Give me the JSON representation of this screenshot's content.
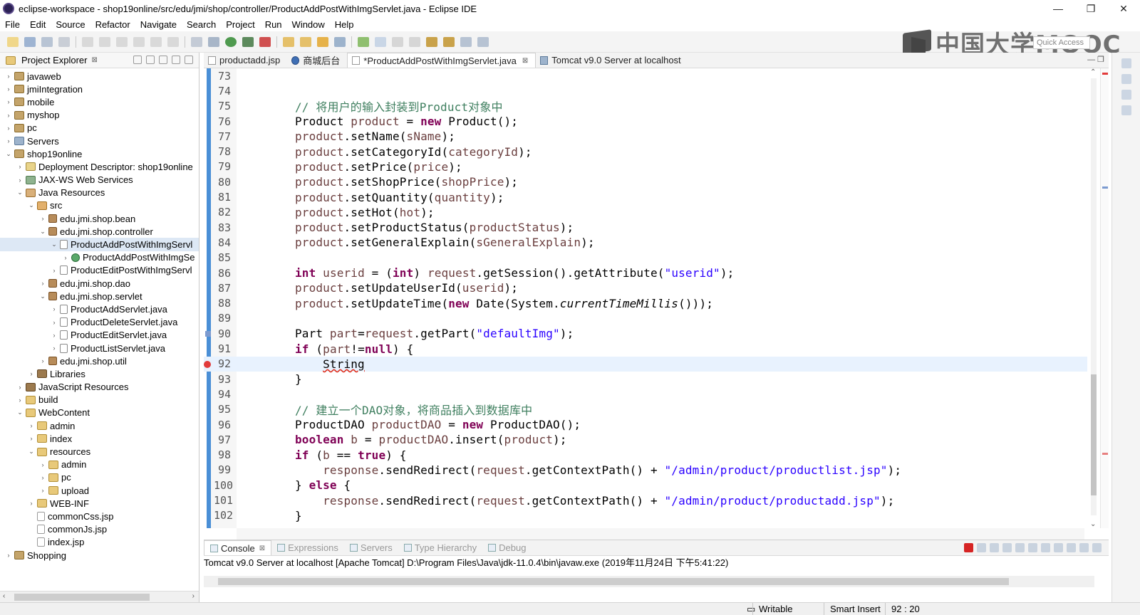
{
  "window": {
    "title": "eclipse-workspace - shop19online/src/edu/jmi/shop/controller/ProductAddPostWithImgServlet.java - Eclipse IDE",
    "controls": [
      "—",
      "❐",
      "✕"
    ]
  },
  "menu": [
    "File",
    "Edit",
    "Source",
    "Refactor",
    "Navigate",
    "Search",
    "Project",
    "Run",
    "Window",
    "Help"
  ],
  "watermark": "中国大学MOOC",
  "quick_access": "Quick Access",
  "explorer": {
    "title": "Project Explorer",
    "close": "⊠",
    "items": [
      {
        "label": "javaweb",
        "twisty": "›",
        "icon": "project"
      },
      {
        "label": "jmiIntegration",
        "twisty": "›",
        "icon": "project"
      },
      {
        "label": "mobile",
        "twisty": "›",
        "icon": "project"
      },
      {
        "label": "myshop",
        "twisty": "›",
        "icon": "project"
      },
      {
        "label": "pc",
        "twisty": "›",
        "icon": "project"
      },
      {
        "label": "Servers",
        "twisty": "›",
        "icon": "server"
      },
      {
        "label": "shop19online",
        "twisty": "⌄",
        "icon": "project"
      },
      {
        "label": "Deployment Descriptor: shop19online",
        "twisty": "›",
        "icon": "desc"
      },
      {
        "label": "JAX-WS Web Services",
        "twisty": "›",
        "icon": "ws"
      },
      {
        "label": "Java Resources",
        "twisty": "⌄",
        "icon": "jres"
      },
      {
        "label": "src",
        "twisty": "⌄",
        "icon": "src"
      },
      {
        "label": "edu.jmi.shop.bean",
        "twisty": "›",
        "icon": "pkg"
      },
      {
        "label": "edu.jmi.shop.controller",
        "twisty": "⌄",
        "icon": "pkg"
      },
      {
        "label": "ProductAddPostWithImgServl",
        "twisty": "⌄",
        "icon": "java",
        "selected": true
      },
      {
        "label": "ProductAddPostWithImgSe",
        "twisty": "›",
        "icon": "class"
      },
      {
        "label": "ProductEditPostWithImgServl",
        "twisty": "›",
        "icon": "java"
      },
      {
        "label": "edu.jmi.shop.dao",
        "twisty": "›",
        "icon": "pkg"
      },
      {
        "label": "edu.jmi.shop.servlet",
        "twisty": "⌄",
        "icon": "pkg"
      },
      {
        "label": "ProductAddServlet.java",
        "twisty": "›",
        "icon": "java"
      },
      {
        "label": "ProductDeleteServlet.java",
        "twisty": "›",
        "icon": "java"
      },
      {
        "label": "ProductEditServlet.java",
        "twisty": "›",
        "icon": "java"
      },
      {
        "label": "ProductListServlet.java",
        "twisty": "›",
        "icon": "java"
      },
      {
        "label": "edu.jmi.shop.util",
        "twisty": "›",
        "icon": "pkg"
      },
      {
        "label": "Libraries",
        "twisty": "›",
        "icon": "lib"
      },
      {
        "label": "JavaScript Resources",
        "twisty": "›",
        "icon": "lib"
      },
      {
        "label": "build",
        "twisty": "›",
        "icon": "folder"
      },
      {
        "label": "WebContent",
        "twisty": "⌄",
        "icon": "folder"
      },
      {
        "label": "admin",
        "twisty": "›",
        "icon": "folder"
      },
      {
        "label": "index",
        "twisty": "›",
        "icon": "folder"
      },
      {
        "label": "resources",
        "twisty": "⌄",
        "icon": "folder"
      },
      {
        "label": "admin",
        "twisty": "›",
        "icon": "folder"
      },
      {
        "label": "pc",
        "twisty": "›",
        "icon": "folder"
      },
      {
        "label": "upload",
        "twisty": "›",
        "icon": "folder"
      },
      {
        "label": "WEB-INF",
        "twisty": "›",
        "icon": "folder"
      },
      {
        "label": "commonCss.jsp",
        "twisty": "",
        "icon": "jsp"
      },
      {
        "label": "commonJs.jsp",
        "twisty": "",
        "icon": "jsp"
      },
      {
        "label": "index.jsp",
        "twisty": "",
        "icon": "jsp"
      },
      {
        "label": "Shopping",
        "twisty": "›",
        "icon": "project"
      }
    ]
  },
  "editor": {
    "tabs": [
      {
        "label": "productadd.jsp",
        "icon": "file",
        "active": false,
        "close": ""
      },
      {
        "label": "商城后台",
        "icon": "globe",
        "active": false,
        "close": ""
      },
      {
        "label": "*ProductAddPostWithImgServlet.java",
        "icon": "file",
        "active": true,
        "close": "⊠"
      },
      {
        "label": "Tomcat v9.0 Server at localhost",
        "icon": "server",
        "active": false,
        "close": ""
      }
    ],
    "current_line": 92,
    "lines": [
      {
        "n": "73",
        "html": ""
      },
      {
        "n": "74",
        "html": ""
      },
      {
        "n": "75",
        "html": "<span class=\"cmt\">// 将用户的输入封装到Product对象中</span>"
      },
      {
        "n": "76",
        "html": "Product <span class=\"var\">product</span> = <span class=\"kw\">new</span> Product();"
      },
      {
        "n": "77",
        "html": "<span class=\"var\">product</span>.setName(<span class=\"var\">sName</span>);"
      },
      {
        "n": "78",
        "html": "<span class=\"var\">product</span>.setCategoryId(<span class=\"var\">categoryId</span>);"
      },
      {
        "n": "79",
        "html": "<span class=\"var\">product</span>.setPrice(<span class=\"var\">price</span>);"
      },
      {
        "n": "80",
        "html": "<span class=\"var\">product</span>.setShopPrice(<span class=\"var\">shopPrice</span>);"
      },
      {
        "n": "81",
        "html": "<span class=\"var\">product</span>.setQuantity(<span class=\"var\">quantity</span>);"
      },
      {
        "n": "82",
        "html": "<span class=\"var\">product</span>.setHot(<span class=\"var\">hot</span>);"
      },
      {
        "n": "83",
        "html": "<span class=\"var\">product</span>.setProductStatus(<span class=\"var\">productStatus</span>);"
      },
      {
        "n": "84",
        "html": "<span class=\"var\">product</span>.setGeneralExplain(<span class=\"var\">sGeneralExplain</span>);"
      },
      {
        "n": "85",
        "html": ""
      },
      {
        "n": "86",
        "html": "<span class=\"kw\">int</span> <span class=\"var\">userid</span> = (<span class=\"kw\">int</span>) <span class=\"var\">request</span>.getSession().getAttribute(<span class=\"str\">\"userid\"</span>);"
      },
      {
        "n": "87",
        "html": "<span class=\"var\">product</span>.setUpdateUserId(<span class=\"var\">userid</span>);"
      },
      {
        "n": "88",
        "html": "<span class=\"var\">product</span>.setUpdateTime(<span class=\"kw\">new</span> Date(System.<span class=\"itl\">currentTimeMillis</span>()));"
      },
      {
        "n": "89",
        "html": ""
      },
      {
        "n": "90",
        "html": "Part <span class=\"var\">part</span>=<span class=\"var\">request</span>.getPart(<span class=\"str\">\"defaultImg\"</span>);"
      },
      {
        "n": "91",
        "html": "<span class=\"kw\">if</span> (<span class=\"var\">part</span>!=<span class=\"kw\">null</span>) {"
      },
      {
        "n": "92",
        "html": "    <span class=\"err\">String</span>"
      },
      {
        "n": "93",
        "html": "}"
      },
      {
        "n": "94",
        "html": ""
      },
      {
        "n": "95",
        "html": "<span class=\"cmt\">// 建立一个DAO对象，将商品插入到数据库中</span>"
      },
      {
        "n": "96",
        "html": "ProductDAO <span class=\"var\">productDAO</span> = <span class=\"kw\">new</span> ProductDAO();"
      },
      {
        "n": "97",
        "html": "<span class=\"kw\">boolean</span> <span class=\"var\">b</span> = <span class=\"var\">productDAO</span>.insert(<span class=\"var\">product</span>);"
      },
      {
        "n": "98",
        "html": "<span class=\"kw\">if</span> (<span class=\"var\">b</span> == <span class=\"kw\">true</span>) {"
      },
      {
        "n": "99",
        "html": "    <span class=\"var\">response</span>.sendRedirect(<span class=\"var\">request</span>.getContextPath() + <span class=\"str\">\"/admin/product/productlist.jsp\"</span>);"
      },
      {
        "n": "100",
        "html": "} <span class=\"kw\">else</span> {"
      },
      {
        "n": "101",
        "html": "    <span class=\"var\">response</span>.sendRedirect(<span class=\"var\">request</span>.getContextPath() + <span class=\"str\">\"/admin/product/productadd.jsp\"</span>);"
      },
      {
        "n": "102",
        "html": "}"
      }
    ]
  },
  "console": {
    "tabs": [
      {
        "label": "Console",
        "active": true,
        "close": "⊠"
      },
      {
        "label": "Expressions",
        "active": false,
        "close": ""
      },
      {
        "label": "Servers",
        "active": false,
        "close": ""
      },
      {
        "label": "Type Hierarchy",
        "active": false,
        "close": ""
      },
      {
        "label": "Debug",
        "active": false,
        "close": ""
      }
    ],
    "line": "Tomcat v9.0 Server at localhost [Apache Tomcat] D:\\Program Files\\Java\\jdk-11.0.4\\bin\\javaw.exe (2019年11月24日 下午5:41:22)"
  },
  "status": {
    "writable": "Writable",
    "insert_mode": "Smart Insert",
    "position": "92 : 20"
  },
  "colors": {
    "keyword": "#7f0055",
    "string": "#2a00ff",
    "comment": "#3f7f5f",
    "variable": "#6a3e3e",
    "current_line": "#e8f2fe",
    "ruler": "#4a8fd6"
  }
}
